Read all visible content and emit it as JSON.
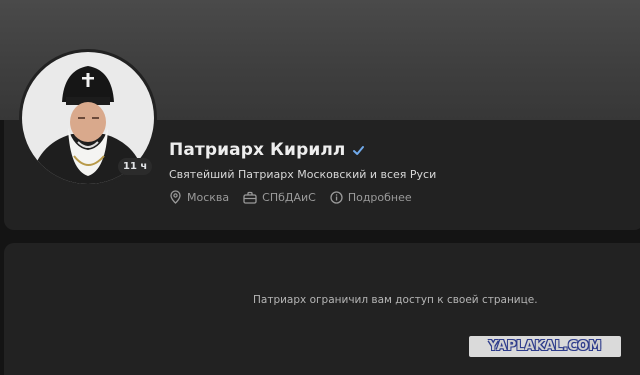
{
  "profile": {
    "name": "Патриарх Кирилл",
    "status": "Святейший Патриарх Московский и всея Руси",
    "online_badge": "11 ч",
    "verified_icon": "checkmark-icon",
    "meta": [
      {
        "icon": "location-icon",
        "label": "Москва"
      },
      {
        "icon": "briefcase-icon",
        "label": "СПбДАиС"
      },
      {
        "icon": "info-icon",
        "label": "Подробнее"
      }
    ]
  },
  "content": {
    "private_message": "Патриарх ограничил вам доступ к своей странице."
  },
  "watermark": {
    "text": "YAPLAKAL.COM"
  },
  "colors": {
    "background": "#141414",
    "card": "#222222",
    "verified": "#71aaeb"
  }
}
